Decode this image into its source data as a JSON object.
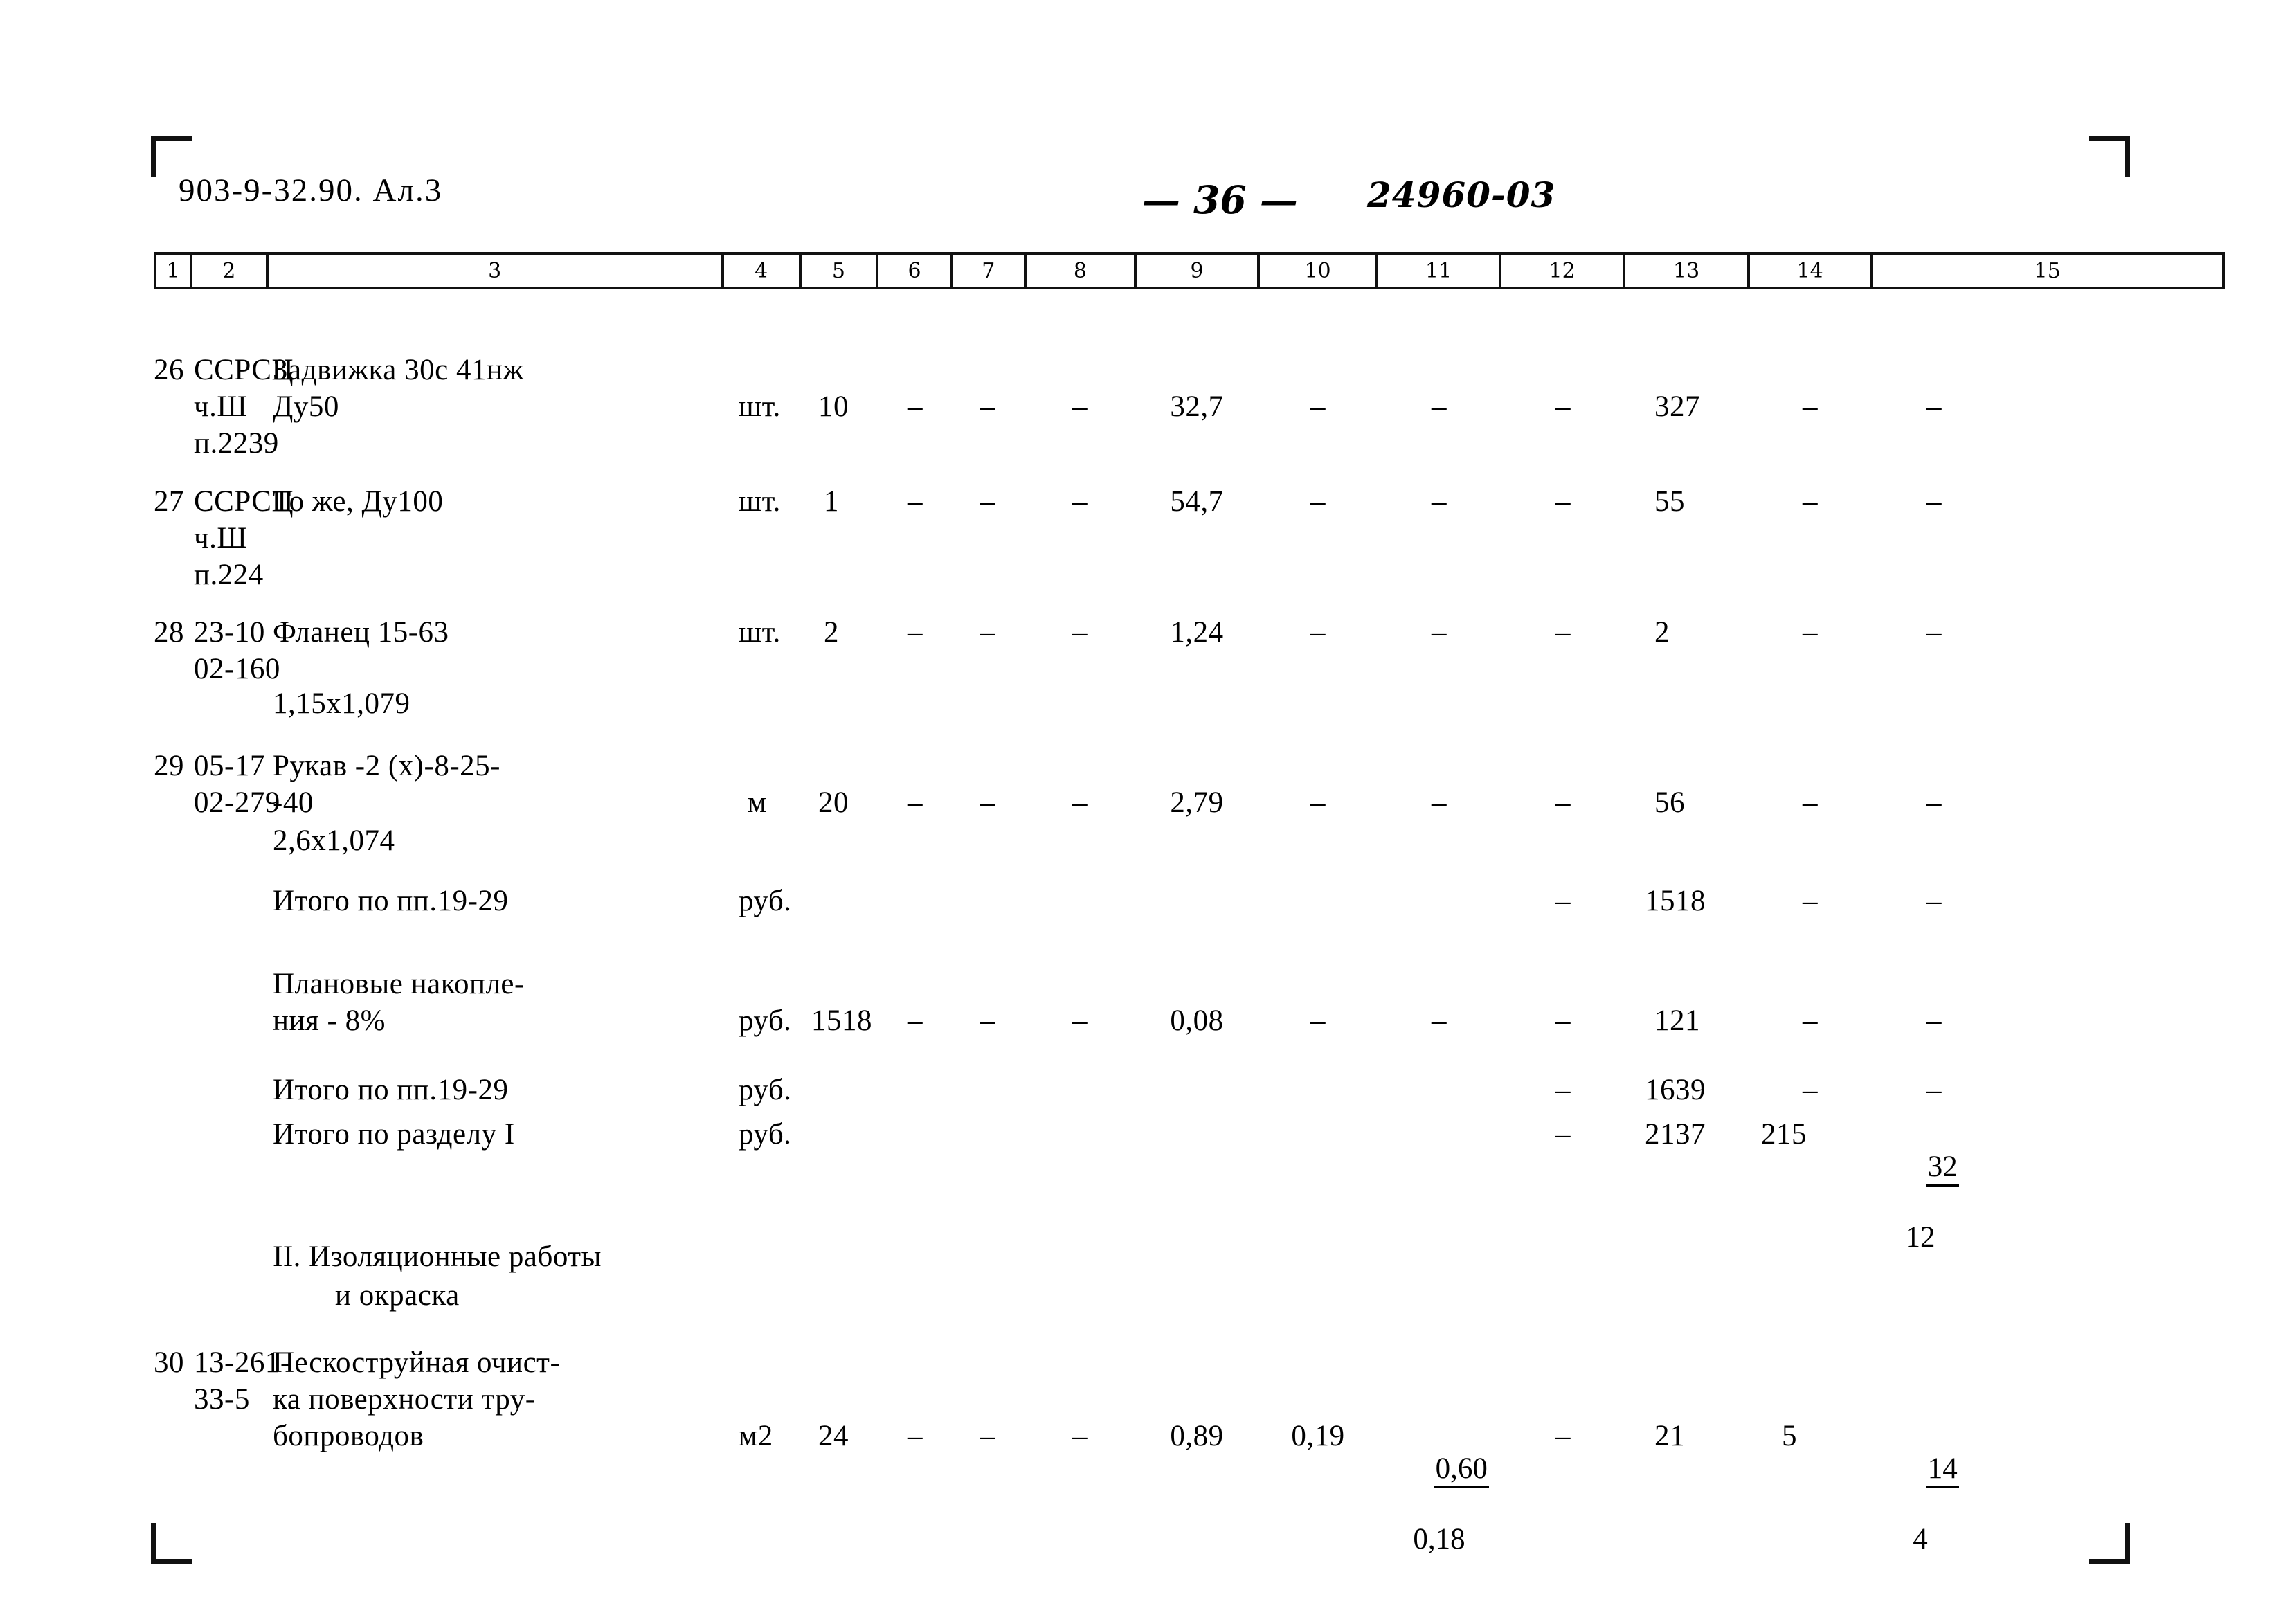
{
  "header": {
    "doc_code": "903-9-32.90. Ал.3",
    "page_number": "36",
    "hand_annotation": "24960-03"
  },
  "table": {
    "column_headers": [
      "1",
      "2",
      "3",
      "4",
      "5",
      "6",
      "7",
      "8",
      "9",
      "10",
      "11",
      "12",
      "13",
      "14",
      "15"
    ],
    "dash": "–",
    "rows": [
      {
        "name": "row-26",
        "c1": "26",
        "c2": "ССРСЦ\nч.Ш\nп.2239",
        "c3": "Задвижка 30с 41нж\nДу50",
        "c4": "шт.",
        "c5": "10",
        "c6": "–",
        "c7": "–",
        "c8": "–",
        "c9": "32,7",
        "c10": "–",
        "c11": "–",
        "c12": "–",
        "c13": "327",
        "c14": "–",
        "c15": "–"
      },
      {
        "name": "row-27",
        "c1": "27",
        "c2": "ССРСЦ\nч.Ш\nп.224",
        "c3": "То же, Ду100",
        "c4": "шт.",
        "c5": "1",
        "c6": "–",
        "c7": "–",
        "c8": "–",
        "c9": "54,7",
        "c10": "–",
        "c11": "–",
        "c12": "–",
        "c13": "55",
        "c14": "–",
        "c15": "–"
      },
      {
        "name": "row-28",
        "c1": "28",
        "c2": "23-10\n02-160",
        "c3": "Фланец 15-63",
        "c3b": "1,15х1,079",
        "c4": "шт.",
        "c5": "2",
        "c6": "–",
        "c7": "–",
        "c8": "–",
        "c9": "1,24",
        "c10": "–",
        "c11": "–",
        "c12": "–",
        "c13": "2",
        "c14": "–",
        "c15": "–"
      },
      {
        "name": "row-29",
        "c1": "29",
        "c2": "05-17\n02-279",
        "c3": "Рукав -2 (х)-8-25-\n-40",
        "c3b": "2,6х1,074",
        "c4": "м",
        "c5": "20",
        "c6": "–",
        "c7": "–",
        "c8": "–",
        "c9": "2,79",
        "c10": "–",
        "c11": "–",
        "c12": "–",
        "c13": "56",
        "c14": "–",
        "c15": "–"
      }
    ],
    "totals": [
      {
        "name": "total-items-19-29-a",
        "label": "Итого по пп.19-29",
        "unit": "руб.",
        "c12": "–",
        "c13": "1518",
        "c14": "–",
        "c15": "–"
      },
      {
        "name": "planned-savings",
        "label": "Плановые накопле-\nния - 8%",
        "unit": "руб.",
        "c5": "1518",
        "c6": "–",
        "c7": "–",
        "c8": "–",
        "c9": "0,08",
        "c10": "–",
        "c11": "–",
        "c12": "–",
        "c13": "121",
        "c14": "–",
        "c15": "–"
      },
      {
        "name": "total-items-19-29-b",
        "label": "Итого по пп.19-29",
        "unit": "руб.",
        "c12": "–",
        "c13": "1639",
        "c14": "–",
        "c15": "–"
      },
      {
        "name": "total-section-1",
        "label": "Итого по разделу I",
        "unit": "руб.",
        "c12": "–",
        "c13": "2137",
        "c14": "215",
        "c15_top": "32",
        "c15_bottom": "12"
      }
    ],
    "section_heading": "II. Изоляционные работы\n        и окраска",
    "rows_after_heading": [
      {
        "name": "row-30",
        "c1": "30",
        "c2": "13-261-\n33-5",
        "c3": "Пескоструйная очист-\nка поверхности тру-\nбопроводов",
        "c4": "м2",
        "c5": "24",
        "c6": "–",
        "c7": "–",
        "c8": "–",
        "c9": "0,89",
        "c10": "0,19",
        "c11_top": "0,60",
        "c11_bottom": "0,18",
        "c12": "–",
        "c13": "21",
        "c14": "5",
        "c15_top": "14",
        "c15_bottom": "4"
      }
    ]
  }
}
